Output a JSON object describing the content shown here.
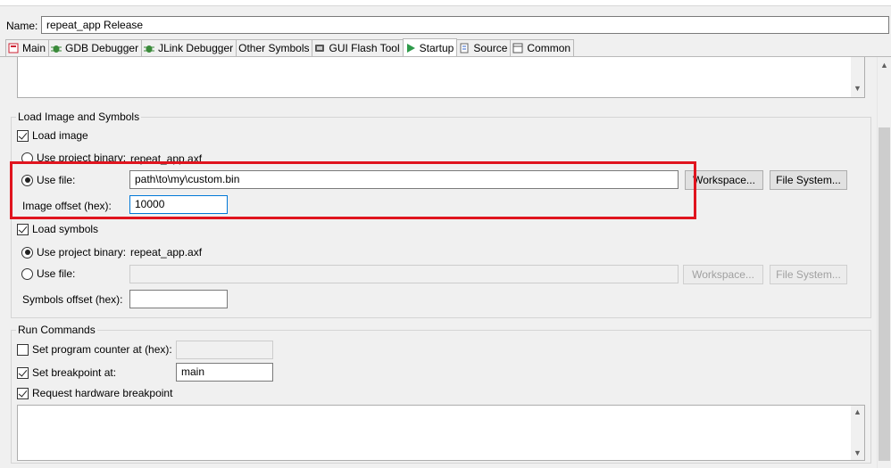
{
  "name_field": {
    "label": "Name:",
    "value": "repeat_app Release"
  },
  "tabs": [
    {
      "label": "Main",
      "icon": "main-tab-icon",
      "active": false
    },
    {
      "label": "GDB Debugger",
      "icon": "bug-icon",
      "active": false
    },
    {
      "label": "JLink Debugger",
      "icon": "bug-icon",
      "active": false
    },
    {
      "label": "Other Symbols",
      "icon": "",
      "active": false
    },
    {
      "label": "GUI Flash Tool",
      "icon": "flash-icon",
      "active": false
    },
    {
      "label": "Startup",
      "icon": "play-icon",
      "active": true
    },
    {
      "label": "Source",
      "icon": "source-icon",
      "active": false
    },
    {
      "label": "Common",
      "icon": "common-icon",
      "active": false
    }
  ],
  "load_image_group": {
    "title": "Load Image and Symbols",
    "load_image": {
      "label": "Load image",
      "checked": true
    },
    "use_project_binary": {
      "label": "Use project binary:",
      "value": "repeat_app.axf",
      "selected": false
    },
    "use_file": {
      "label": "Use file:",
      "value": "path\\to\\my\\custom.bin",
      "selected": true
    },
    "workspace_button": "Workspace...",
    "filesystem_button": "File System...",
    "image_offset": {
      "label": "Image offset (hex):",
      "value": "10000"
    },
    "load_symbols": {
      "label": "Load symbols",
      "checked": true
    },
    "sym_use_project_binary": {
      "label": "Use project binary:",
      "value": "repeat_app.axf",
      "selected": true
    },
    "sym_use_file": {
      "label": "Use file:",
      "value": "",
      "selected": false
    },
    "sym_workspace_button": "Workspace...",
    "sym_filesystem_button": "File System...",
    "symbols_offset": {
      "label": "Symbols offset (hex):",
      "value": ""
    }
  },
  "run_commands_group": {
    "title": "Run Commands",
    "set_pc": {
      "label": "Set program counter at (hex):",
      "checked": false,
      "value": ""
    },
    "set_breakpoint": {
      "label": "Set breakpoint at:",
      "checked": true,
      "value": "main"
    },
    "hw_breakpoint": {
      "label": "Request hardware breakpoint",
      "checked": true
    }
  },
  "colors": {
    "highlight_box": "#e0141e",
    "focus_border": "#0078d7"
  }
}
